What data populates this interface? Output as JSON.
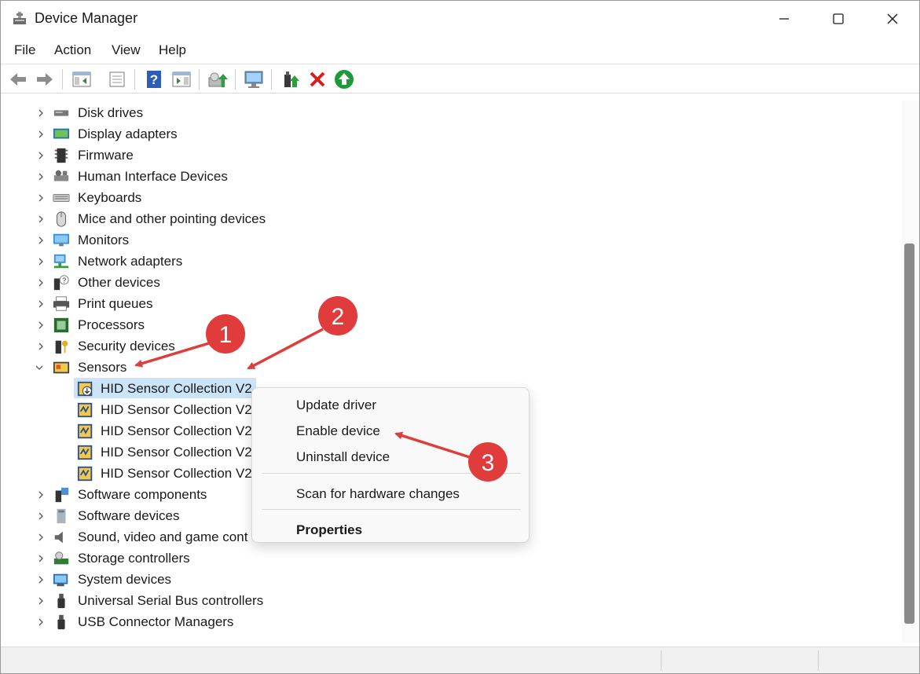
{
  "window": {
    "title": "Device Manager",
    "app_icon": "device-manager-icon"
  },
  "title_buttons": [
    "minimize-icon",
    "maximize-icon",
    "close-icon"
  ],
  "menu": [
    "File",
    "Action",
    "View",
    "Help"
  ],
  "toolbar_icons": [
    "back-arrow-icon",
    "forward-arrow-icon",
    "show-hide-console-tree-icon",
    "properties-icon",
    "help-icon",
    "action-pane-icon",
    "update-driver-icon",
    "scan-hardware-icon",
    "enable-device-icon",
    "uninstall-device-icon",
    "add-legacy-hardware-icon"
  ],
  "tree": {
    "items": [
      {
        "label": "Disk drives",
        "icon": "disk-drive-icon",
        "expanded": false
      },
      {
        "label": "Display adapters",
        "icon": "display-adapter-icon",
        "expanded": false
      },
      {
        "label": "Firmware",
        "icon": "firmware-chip-icon",
        "expanded": false
      },
      {
        "label": "Human Interface Devices",
        "icon": "hid-icon",
        "expanded": false
      },
      {
        "label": "Keyboards",
        "icon": "keyboard-icon",
        "expanded": false
      },
      {
        "label": "Mice and other pointing devices",
        "icon": "mouse-icon",
        "expanded": false
      },
      {
        "label": "Monitors",
        "icon": "monitor-icon",
        "expanded": false
      },
      {
        "label": "Network adapters",
        "icon": "network-adapter-icon",
        "expanded": false
      },
      {
        "label": "Other devices",
        "icon": "unknown-device-icon",
        "expanded": false
      },
      {
        "label": "Print queues",
        "icon": "printer-icon",
        "expanded": false
      },
      {
        "label": "Processors",
        "icon": "processor-icon",
        "expanded": false
      },
      {
        "label": "Security devices",
        "icon": "security-key-icon",
        "expanded": false
      },
      {
        "label": "Sensors",
        "icon": "sensor-icon",
        "expanded": true
      },
      {
        "label": "Software components",
        "icon": "software-component-icon",
        "expanded": false
      },
      {
        "label": "Software devices",
        "icon": "software-device-icon",
        "expanded": false
      },
      {
        "label": "Sound, video and game cont",
        "icon": "speaker-icon",
        "expanded": false
      },
      {
        "label": "Storage controllers",
        "icon": "storage-controller-icon",
        "expanded": false
      },
      {
        "label": "System devices",
        "icon": "system-device-icon",
        "expanded": false
      },
      {
        "label": "Universal Serial Bus controllers",
        "icon": "usb-icon",
        "expanded": false
      },
      {
        "label": "USB Connector Managers",
        "icon": "usb-connector-icon",
        "expanded": false
      }
    ],
    "sensor_children": [
      {
        "label": "HID Sensor Collection V2",
        "status": "disabled",
        "selected": true
      },
      {
        "label": "HID Sensor Collection V2",
        "status": "ok",
        "selected": false
      },
      {
        "label": "HID Sensor Collection V2",
        "status": "ok",
        "selected": false
      },
      {
        "label": "HID Sensor Collection V2",
        "status": "ok",
        "selected": false
      },
      {
        "label": "HID Sensor Collection V2",
        "status": "ok",
        "selected": false
      }
    ]
  },
  "context_menu": {
    "update_driver": "Update driver",
    "enable_device": "Enable device",
    "uninstall_device": "Uninstall device",
    "scan": "Scan for hardware changes",
    "properties": "Properties"
  },
  "annotations": {
    "step1": "1",
    "step2": "2",
    "step3": "3",
    "color": "#e03c3c"
  },
  "colors": {
    "selection": "#cce4f7",
    "accent_red": "#e03c3c",
    "scroll_thumb": "#8a8a8a"
  }
}
